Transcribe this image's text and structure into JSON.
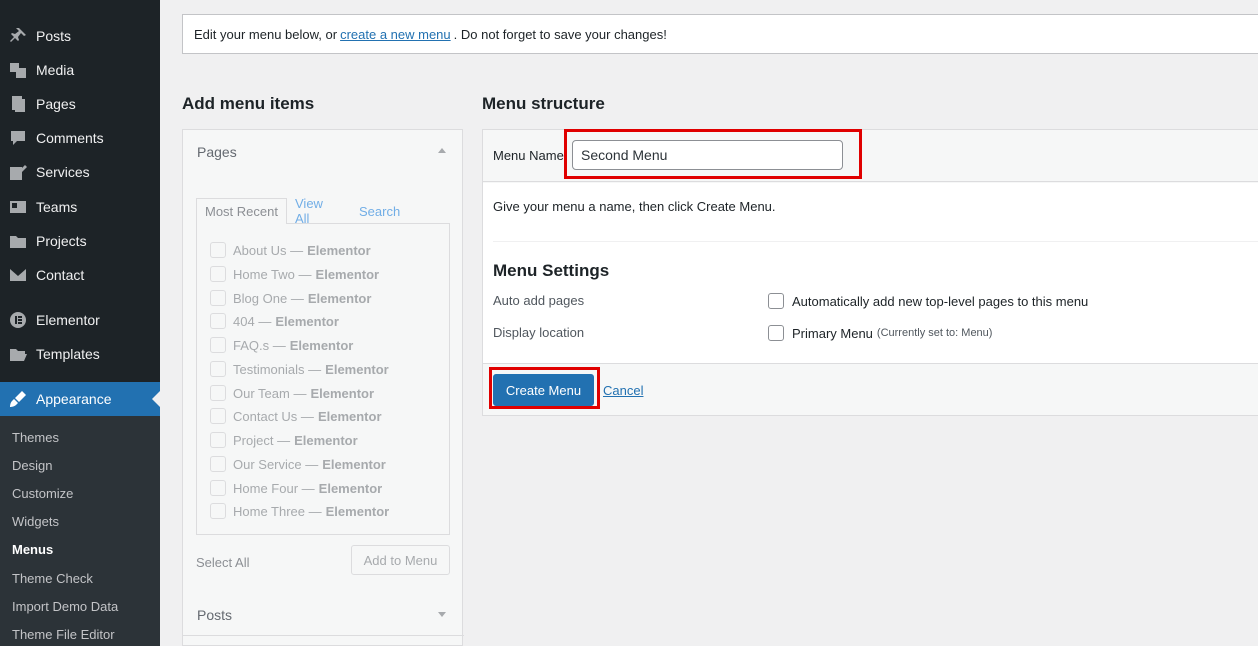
{
  "sidebar": {
    "items": [
      {
        "label": "Posts",
        "icon": "pin-icon"
      },
      {
        "label": "Media",
        "icon": "media-icon"
      },
      {
        "label": "Pages",
        "icon": "pages-icon"
      },
      {
        "label": "Comments",
        "icon": "comment-icon"
      },
      {
        "label": "Services",
        "icon": "edit-icon"
      },
      {
        "label": "Teams",
        "icon": "id-card-icon"
      },
      {
        "label": "Projects",
        "icon": "folder-icon"
      },
      {
        "label": "Contact",
        "icon": "envelope-icon"
      },
      {
        "label": "Elementor",
        "icon": "elementor-icon"
      },
      {
        "label": "Templates",
        "icon": "folder-open-icon"
      },
      {
        "label": "Appearance",
        "icon": "brush-icon",
        "active": true
      }
    ],
    "submenu": [
      "Themes",
      "Design",
      "Customize",
      "Widgets",
      "Menus",
      "Theme Check",
      "Import Demo Data",
      "Theme File Editor"
    ],
    "current_submenu": "Menus"
  },
  "notice": {
    "before": "Edit your menu below, or",
    "link": "create a new menu",
    "after": ". Do not forget to save your changes!"
  },
  "left": {
    "heading": "Add menu items",
    "pages_box": {
      "title": "Pages",
      "tabs": [
        "Most Recent",
        "View All",
        "Search"
      ],
      "items": [
        {
          "title": "About Us",
          "suffix": "Elementor"
        },
        {
          "title": "Home Two",
          "suffix": "Elementor"
        },
        {
          "title": "Blog One",
          "suffix": "Elementor"
        },
        {
          "title": "404",
          "suffix": "Elementor"
        },
        {
          "title": "FAQ.s",
          "suffix": "Elementor"
        },
        {
          "title": "Testimonials",
          "suffix": "Elementor"
        },
        {
          "title": "Our Team",
          "suffix": "Elementor"
        },
        {
          "title": "Contact Us",
          "suffix": "Elementor"
        },
        {
          "title": "Project",
          "suffix": "Elementor"
        },
        {
          "title": "Our Service",
          "suffix": "Elementor"
        },
        {
          "title": "Home Four",
          "suffix": "Elementor"
        },
        {
          "title": "Home Three",
          "suffix": "Elementor"
        }
      ],
      "select_all": "Select All",
      "add_button": "Add to Menu"
    },
    "posts_box": {
      "title": "Posts"
    }
  },
  "right": {
    "heading": "Menu structure",
    "menu_name_label": "Menu Name",
    "menu_name_value": "Second Menu",
    "instructions": "Give your menu a name, then click Create Menu.",
    "settings_title": "Menu Settings",
    "auto_add_label": "Auto add pages",
    "auto_add_option": "Automatically add new top-level pages to this menu",
    "display_location_label": "Display location",
    "location_option": "Primary Menu",
    "location_note": "(Currently set to: Menu)",
    "create_button": "Create Menu",
    "cancel_link": "Cancel"
  },
  "colors": {
    "sidebar_bg": "#1d2327",
    "accent": "#2271b1",
    "highlight": "#e00000"
  }
}
